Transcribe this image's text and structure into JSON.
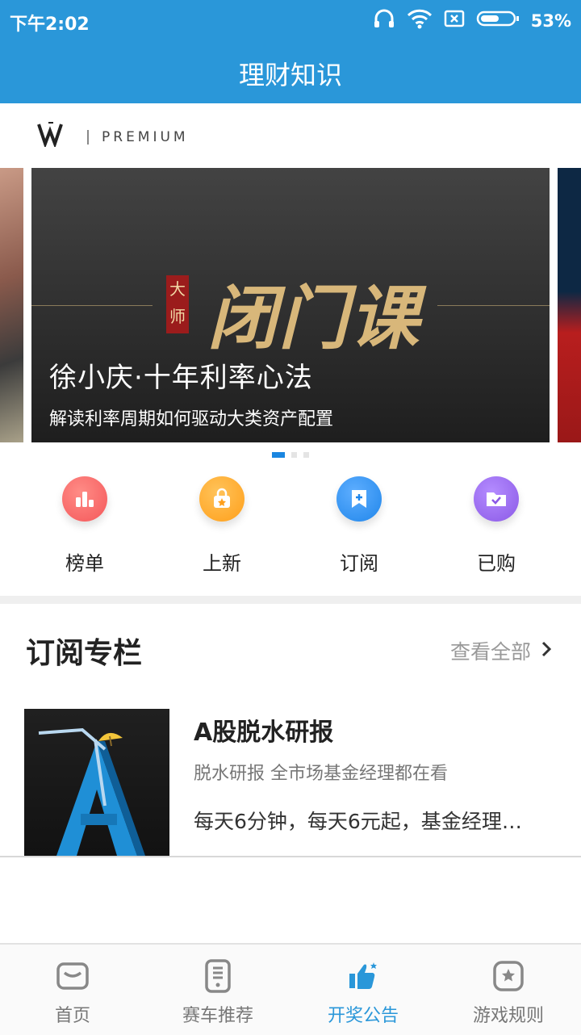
{
  "status_bar": {
    "time": "下午2:02",
    "battery": "53%"
  },
  "header": {
    "title": "理财知识"
  },
  "brand": {
    "text": "PREMIUM"
  },
  "banner": {
    "seal": "大师",
    "calligraphy": "闭门课",
    "title": "徐小庆·十年利率心法",
    "subtitle": "解读利率周期如何驱动大类资产配置"
  },
  "quick_actions": [
    {
      "label": "榜单",
      "icon": "chart-icon",
      "color": "#f4575a"
    },
    {
      "label": "上新",
      "icon": "bag-icon",
      "color": "#ff9f1a"
    },
    {
      "label": "订阅",
      "icon": "bookmark-icon",
      "color": "#2086ea"
    },
    {
      "label": "已购",
      "icon": "folder-icon",
      "color": "#8b59e6"
    }
  ],
  "section": {
    "title": "订阅专栏",
    "more": "查看全部"
  },
  "column_card": {
    "title": "A股脱水研报",
    "tags": "脱水研报  全市场基金经理都在看",
    "description": "每天6分钟，每天6元起，基金经理…"
  },
  "tabs": [
    {
      "label": "首页",
      "icon": "mail-icon"
    },
    {
      "label": "赛车推荐",
      "icon": "phone-icon"
    },
    {
      "label": "开奖公告",
      "icon": "thumbs-up-icon",
      "active": true
    },
    {
      "label": "游戏规则",
      "icon": "star-icon"
    }
  ],
  "colors": {
    "primary": "#2a97d9",
    "active_dot": "#1a86e0"
  }
}
